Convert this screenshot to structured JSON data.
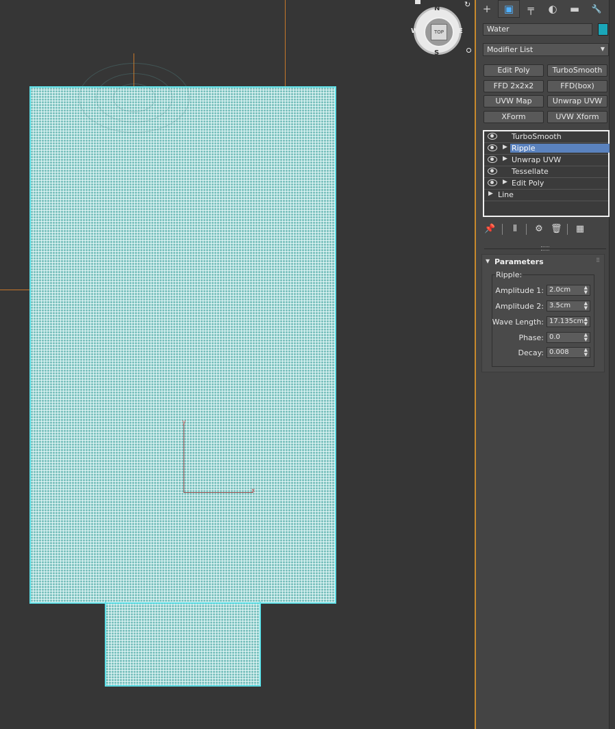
{
  "viewport": {
    "viewcube_face": "TOP",
    "compass": {
      "n": "N",
      "s": "S",
      "e": "E",
      "w": "W"
    },
    "gizmo_axes": {
      "x": "x",
      "y": "y"
    }
  },
  "command_panel": {
    "tabs": [
      {
        "name": "create-tab",
        "icon": "plus-icon",
        "glyph": "+"
      },
      {
        "name": "modify-tab",
        "icon": "modify-icon",
        "glyph": "▣",
        "active": true
      },
      {
        "name": "hierarchy-tab",
        "icon": "hierarchy-icon",
        "glyph": "╤"
      },
      {
        "name": "motion-tab",
        "icon": "motion-icon",
        "glyph": "◐"
      },
      {
        "name": "display-tab",
        "icon": "display-icon",
        "glyph": "▬"
      },
      {
        "name": "utilities-tab",
        "icon": "wrench-icon",
        "glyph": "🔧"
      }
    ],
    "object_name": "Water",
    "object_color": "#1aa6b8",
    "modifier_list_label": "Modifier List",
    "modifier_buttons": [
      "Edit Poly",
      "TurboSmooth",
      "FFD 2x2x2",
      "FFD(box)",
      "UVW Map",
      "Unwrap UVW",
      "XForm",
      "UVW Xform"
    ],
    "stack": [
      {
        "label": "TurboSmooth",
        "eye": true,
        "expand": false
      },
      {
        "label": "Ripple",
        "eye": true,
        "expand": true,
        "selected": true
      },
      {
        "label": "Unwrap UVW",
        "eye": true,
        "expand": true
      },
      {
        "label": "Tessellate",
        "eye": true,
        "expand": false
      },
      {
        "label": "Edit Poly",
        "eye": true,
        "expand": true
      },
      {
        "label": "Line",
        "eye": false,
        "expand": true
      }
    ],
    "stack_tools": [
      "pin-icon",
      "show-end-result-icon",
      "make-unique-icon",
      "delete-icon",
      "configure-icon"
    ],
    "parameters": {
      "title": "Parameters",
      "group": "Ripple:",
      "rows": [
        {
          "label": "Amplitude 1:",
          "value": "2.0cm"
        },
        {
          "label": "Amplitude 2:",
          "value": "3.5cm"
        },
        {
          "label": "Wave Length:",
          "value": "17.135cm"
        },
        {
          "label": "Phase:",
          "value": "0.0"
        },
        {
          "label": "Decay:",
          "value": "0.008"
        }
      ]
    }
  }
}
